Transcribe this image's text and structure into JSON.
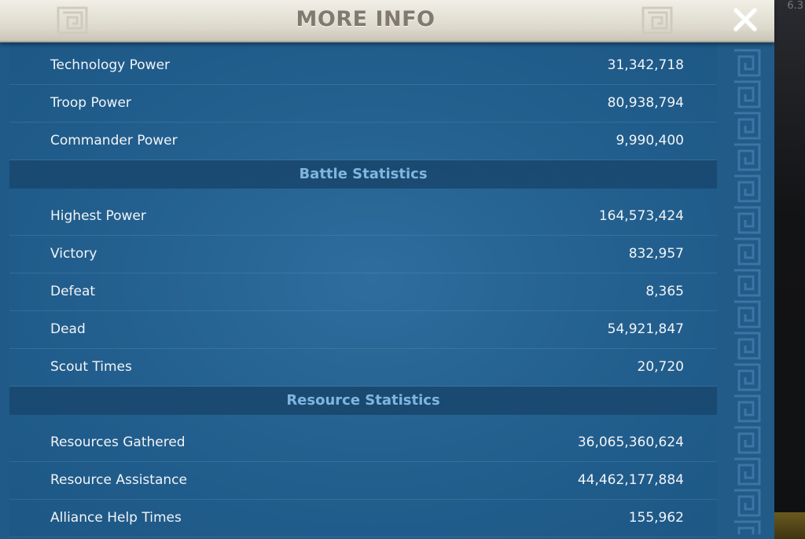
{
  "window": {
    "title": "MORE INFO",
    "corner_text": "6.3"
  },
  "power_rows": [
    {
      "label": "Technology Power",
      "value": "31,342,718"
    },
    {
      "label": "Troop Power",
      "value": "80,938,794"
    },
    {
      "label": "Commander Power",
      "value": "9,990,400"
    }
  ],
  "battle": {
    "title": "Battle Statistics",
    "rows": [
      {
        "label": "Highest Power",
        "value": "164,573,424"
      },
      {
        "label": "Victory",
        "value": "832,957"
      },
      {
        "label": "Defeat",
        "value": "8,365"
      },
      {
        "label": "Dead",
        "value": "54,921,847"
      },
      {
        "label": "Scout Times",
        "value": "20,720"
      }
    ]
  },
  "resource": {
    "title": "Resource Statistics",
    "rows": [
      {
        "label": "Resources Gathered",
        "value": "36,065,360,624"
      },
      {
        "label": "Resource Assistance",
        "value": "44,462,177,884"
      },
      {
        "label": "Alliance Help Times",
        "value": "155,962"
      }
    ]
  },
  "icons": {
    "close": "close-icon",
    "ornament": "meander-ornament-icon"
  },
  "colors": {
    "panel_blue": "#23608f",
    "header_bg": "#e8e5da",
    "title_text": "#807a70",
    "section_title": "#7fb6e0",
    "row_text": "#f2f4f6"
  }
}
